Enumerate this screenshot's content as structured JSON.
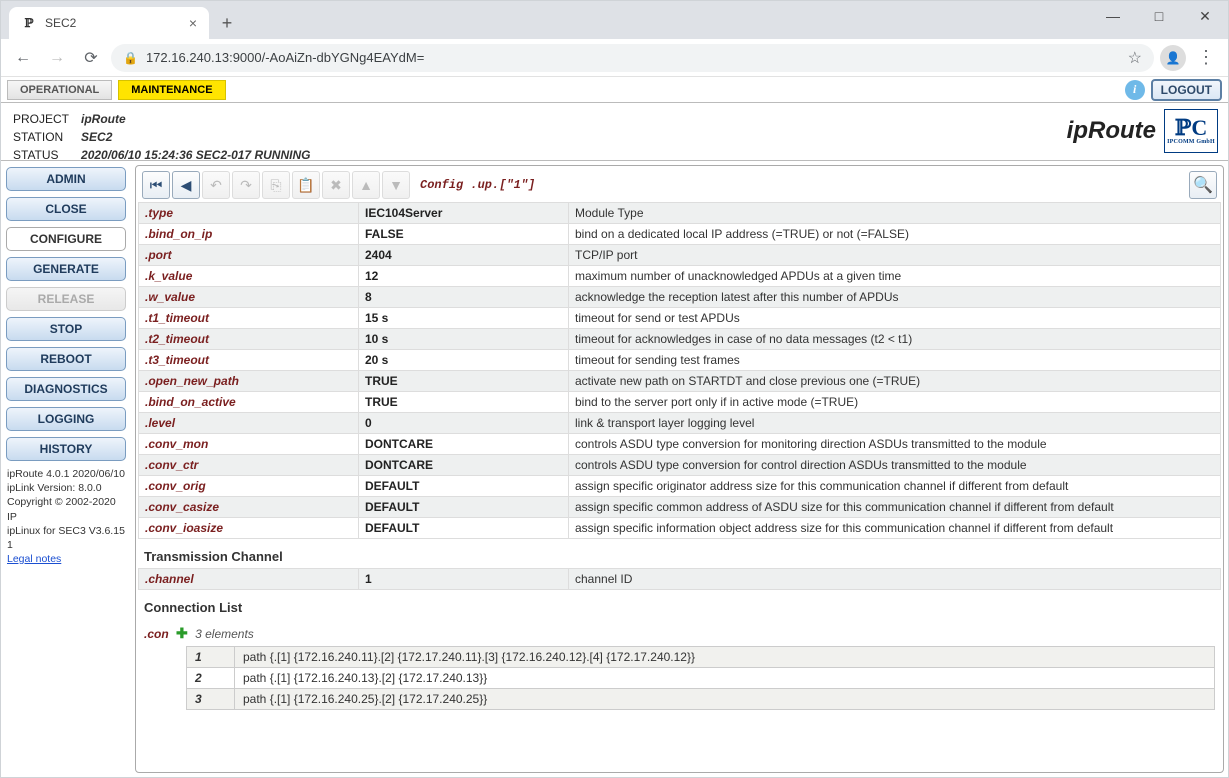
{
  "browser": {
    "tab_title": "SEC2",
    "url": "172.16.240.13:9000/-AoAiZn-dbYGNg4EAYdM="
  },
  "top": {
    "operational": "OPERATIONAL",
    "maintenance": "MAINTENANCE",
    "logout": "LOGOUT"
  },
  "header": {
    "project_label": "PROJECT",
    "project": "ipRoute",
    "station_label": "STATION",
    "station": "SEC2",
    "status_label": "STATUS",
    "status": "2020/06/10 15:24:36 SEC2-017 RUNNING",
    "brand": "ipRoute",
    "brand_sub": "IPCOMM GmbH"
  },
  "sidebar": {
    "btns": [
      "ADMIN",
      "CLOSE",
      "CONFIGURE",
      "GENERATE",
      "RELEASE",
      "STOP",
      "REBOOT",
      "DIAGNOSTICS",
      "LOGGING",
      "HISTORY"
    ],
    "meta1": "ipRoute 4.0.1 2020/06/10",
    "meta2": "ipLink Version: 8.0.0",
    "meta3": "Copyright © 2002-2020 IP",
    "meta4": "ipLinux for SEC3 V3.6.15 1",
    "legal": "Legal notes"
  },
  "crumb": "Config .up.[\"1\"]",
  "params": [
    {
      "k": ".type",
      "v": "IEC104Server",
      "d": "Module Type"
    },
    {
      "k": ".bind_on_ip",
      "v": "FALSE",
      "d": "bind on a dedicated local IP address (=TRUE) or not (=FALSE)"
    },
    {
      "k": ".port",
      "v": "2404",
      "d": "TCP/IP port"
    },
    {
      "k": ".k_value",
      "v": "12",
      "d": "maximum number of unacknowledged APDUs at a given time"
    },
    {
      "k": ".w_value",
      "v": "8",
      "d": "acknowledge the reception latest after this number of APDUs"
    },
    {
      "k": ".t1_timeout",
      "v": "15 s",
      "d": "timeout for send or test APDUs"
    },
    {
      "k": ".t2_timeout",
      "v": "10 s",
      "d": "timeout for acknowledges in case of no data messages (t2 < t1)"
    },
    {
      "k": ".t3_timeout",
      "v": "20 s",
      "d": "timeout for sending test frames"
    },
    {
      "k": ".open_new_path",
      "v": "TRUE",
      "d": "activate new path on STARTDT and close previous one (=TRUE)"
    },
    {
      "k": ".bind_on_active",
      "v": "TRUE",
      "d": "bind to the server port only if in active mode (=TRUE)"
    },
    {
      "k": ".level",
      "v": "0",
      "d": "link & transport layer logging level"
    },
    {
      "k": ".conv_mon",
      "v": "DONTCARE",
      "d": "controls ASDU type conversion for monitoring direction ASDUs transmitted to the module"
    },
    {
      "k": ".conv_ctr",
      "v": "DONTCARE",
      "d": "controls ASDU type conversion for control direction ASDUs transmitted to the module"
    },
    {
      "k": ".conv_orig",
      "v": "DEFAULT",
      "d": "assign specific originator address size for this communication channel if different from default"
    },
    {
      "k": ".conv_casize",
      "v": "DEFAULT",
      "d": "assign specific common address of ASDU size for this communication channel if different from default"
    },
    {
      "k": ".conv_ioasize",
      "v": "DEFAULT",
      "d": "assign specific information object address size for this communication channel if different from default"
    }
  ],
  "trans_title": "Transmission Channel",
  "trans": {
    "k": ".channel",
    "v": "1",
    "d": "channel ID"
  },
  "con_title": "Connection List",
  "con": {
    "key": ".con",
    "count": "3 elements",
    "rows": [
      {
        "i": "1",
        "p": "path {.[1] {172.16.240.11}.[2] {172.17.240.11}.[3] {172.16.240.12}.[4] {172.17.240.12}}"
      },
      {
        "i": "2",
        "p": "path {.[1] {172.16.240.13}.[2] {172.17.240.13}}"
      },
      {
        "i": "3",
        "p": "path {.[1] {172.16.240.25}.[2] {172.17.240.25}}"
      }
    ]
  }
}
